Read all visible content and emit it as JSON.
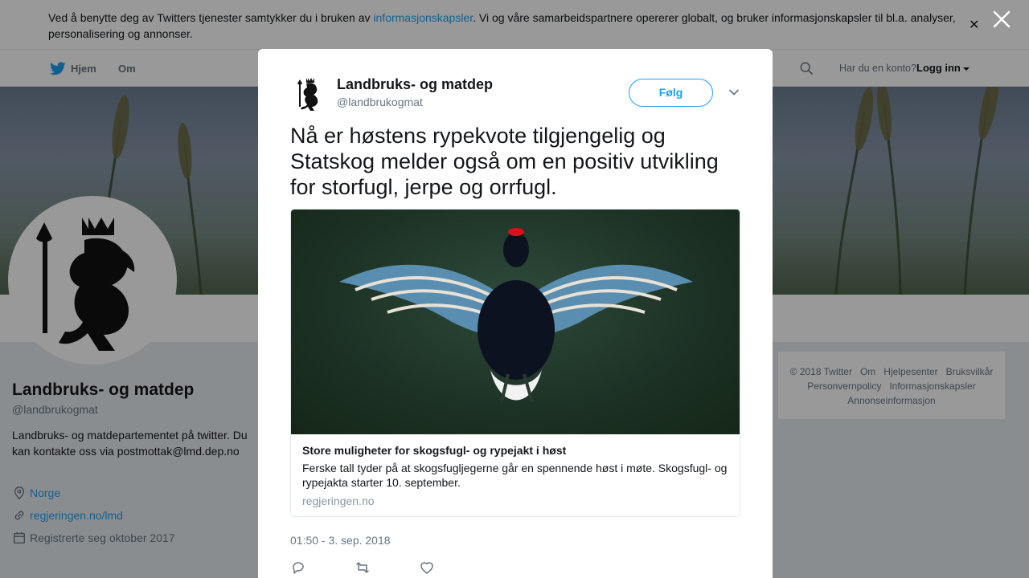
{
  "cookie_banner": {
    "text_before": "Ved å benytte deg av Twitters tjenester samtykker du i bruken av ",
    "link": "informasjonskapsler",
    "text_after": ". Vi og våre samarbeidspartnere opererer globalt, og bruker informasjonskapsler til bl.a. analyser, personalisering og annonser."
  },
  "nav": {
    "home": "Hjem",
    "about": "Om",
    "account_question": "Har du en konto?",
    "login": "Logg inn"
  },
  "profile": {
    "name": "Landbruks- og matdep",
    "handle": "@landbrukogmat",
    "bio": "Landbruks- og matdepartementet på twitter. Du kan kontakte oss via postmottak@lmd.dep.no",
    "location": "Norge",
    "website": "regjeringen.no/lmd",
    "joined": "Registrerte seg oktober 2017"
  },
  "footer": {
    "links": [
      "© 2018 Twitter",
      "Om",
      "Hjelpesenter",
      "Bruksvilkår",
      "Personvernpolicy",
      "Informasjonskapsler",
      "Annonseinformasjon"
    ]
  },
  "tweet": {
    "author_name": "Landbruks- og matdep",
    "author_handle": "@landbrukogmat",
    "follow_label": "Følg",
    "text": "Nå er høstens rypekvote tilgjengelig og Statskog melder også om en positiv utvikling for storfugl, jerpe og orrfugl.",
    "card": {
      "title": "Store muligheter for skogsfugl- og rypejakt i høst",
      "description": "Ferske tall tyder på at skogsfugljegerne går en spennende høst i møte. Skogsfugl- og rypejakta starter 10. september.",
      "domain": "regjeringen.no"
    },
    "timestamp": "01:50 - 3. sep. 2018"
  },
  "colors": {
    "accent": "#1da1f2",
    "muted": "#657786",
    "text": "#14171a"
  },
  "icons": {
    "nav_logo": "twitter-bird-icon",
    "search": "search-icon",
    "close": "close-icon",
    "location": "location-pin-icon",
    "link": "link-icon",
    "calendar": "calendar-icon",
    "reply": "reply-icon",
    "retweet": "retweet-icon",
    "like": "heart-icon",
    "more": "chevron-down-icon"
  }
}
